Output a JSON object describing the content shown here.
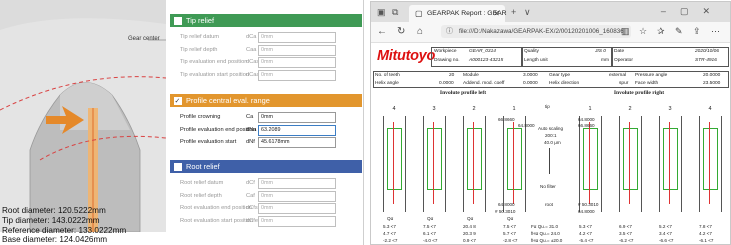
{
  "left_panel": {
    "gear_center_label": "Gear center",
    "diameters": [
      "Root diameter: 120.5222mm",
      "Tip diameter: 143.0222mm",
      "Reference diameter: 133.0222mm",
      "Base diameter: 124.0426mm"
    ],
    "sections": [
      {
        "title": "Tip relief",
        "color": "#3f9a55",
        "checked": false,
        "rows": [
          {
            "label": "Tip relief datum",
            "sym": "dCa",
            "value": "0mm"
          },
          {
            "label": "Tip relief depth",
            "sym": "Caa",
            "value": "0mm"
          },
          {
            "label": "Tip evaluation end position",
            "sym": "dCas",
            "value": "0mm"
          },
          {
            "label": "Tip evaluation start position",
            "sym": "dCaa",
            "value": "0mm"
          }
        ]
      },
      {
        "title": "Profile central eval. range",
        "color": "#e2962e",
        "checked": true,
        "rows": [
          {
            "label": "Profile crowning",
            "sym": "Ca",
            "value": "0mm"
          },
          {
            "label": "Profile evaluation end position",
            "sym": "dNa",
            "value": "63.2089"
          },
          {
            "label": "Profile evaluation start",
            "sym": "dNf",
            "value": "45.6178mm"
          }
        ]
      },
      {
        "title": "Root relief",
        "color": "#3f60a8",
        "checked": false,
        "rows": [
          {
            "label": "Root relief datum",
            "sym": "dCf",
            "value": "0mm"
          },
          {
            "label": "Root relief depth",
            "sym": "Caf",
            "value": "0mm"
          },
          {
            "label": "Root evaluation end position",
            "sym": "dCfs",
            "value": "0mm"
          },
          {
            "label": "Root evaluation start position",
            "sym": "dCfe",
            "value": "0mm"
          }
        ]
      }
    ]
  },
  "browser": {
    "tab_title": "GEARPAK Report : GEAR",
    "url": "file:///D:/Nakazawa/GEARPAK-EX/2/00120201006_160836",
    "report": {
      "brand": "Mitutoyo",
      "header": [
        {
          "label": "Workpiece",
          "value": "GEAR_0314"
        },
        {
          "label": "Drawing no.",
          "value": "A000123-43215"
        },
        {
          "label": "Quality",
          "value": "JIS 0"
        },
        {
          "label": "Length unit",
          "value": "mm"
        },
        {
          "label": "Date",
          "value": "2020/10/06"
        },
        {
          "label": "Operator",
          "value": "STR-4916"
        }
      ],
      "params": [
        {
          "label": "No. of teeth",
          "value": "20"
        },
        {
          "label": "Helix angle",
          "value": "0.0000"
        },
        {
          "label": "Module",
          "value": "3.0000"
        },
        {
          "label": "Addend. mod. coeff",
          "value": "0.0000"
        },
        {
          "label": "Gear type",
          "value": "external"
        },
        {
          "label": "Helix direction",
          "value": "spur"
        },
        {
          "label": "Pressure angle",
          "value": "20.0000"
        },
        {
          "label": "Face width",
          "value": "23.5000"
        }
      ],
      "left_title": "Involute profile left",
      "right_title": "Involute profile right",
      "left_teeth": [
        "4",
        "3",
        "2",
        "1"
      ],
      "right_teeth": [
        "1",
        "2",
        "3",
        "4"
      ],
      "mid_labels": [
        "tip",
        "Auto scaling",
        "200:1",
        "40.0 μm",
        "No filter",
        "root"
      ],
      "top_values": [
        "66.8660",
        "64.8000",
        "64.8000",
        "66.8660"
      ],
      "bottom_values": [
        "64.8000",
        "# 50.3010",
        "# 50.3010",
        "64.8000"
      ],
      "stats_left": [
        [
          "5.3 <7",
          "7.5 <7",
          "20.4 8",
          "7.5 <7"
        ],
        [
          "4.7 <7",
          "6.1 <7",
          "20.3 9",
          "5.7 <7"
        ],
        [
          "-2.2 <7",
          "-4.0 <7",
          "0.9 <7",
          "-2.8 <7"
        ]
      ],
      "stats_mid": [
        "Fα Qu.= 31.0",
        "fHα Qu.= 24.0",
        "fHα Qu.= ±20.0"
      ],
      "stats_right": [
        [
          "5.3 <7",
          "6.9 <7",
          "5.2 <7",
          "7.8 <7"
        ],
        [
          "4.2 <7",
          "3.5 <7",
          "3.4 <7",
          "4.2 <7"
        ],
        [
          "-5.4 <7",
          "-6.2 <7",
          "-6.6 <7",
          "-6.1 <7"
        ]
      ],
      "stat_headers": [
        "Qα",
        "Qα",
        "Qα",
        "Qα"
      ]
    }
  }
}
